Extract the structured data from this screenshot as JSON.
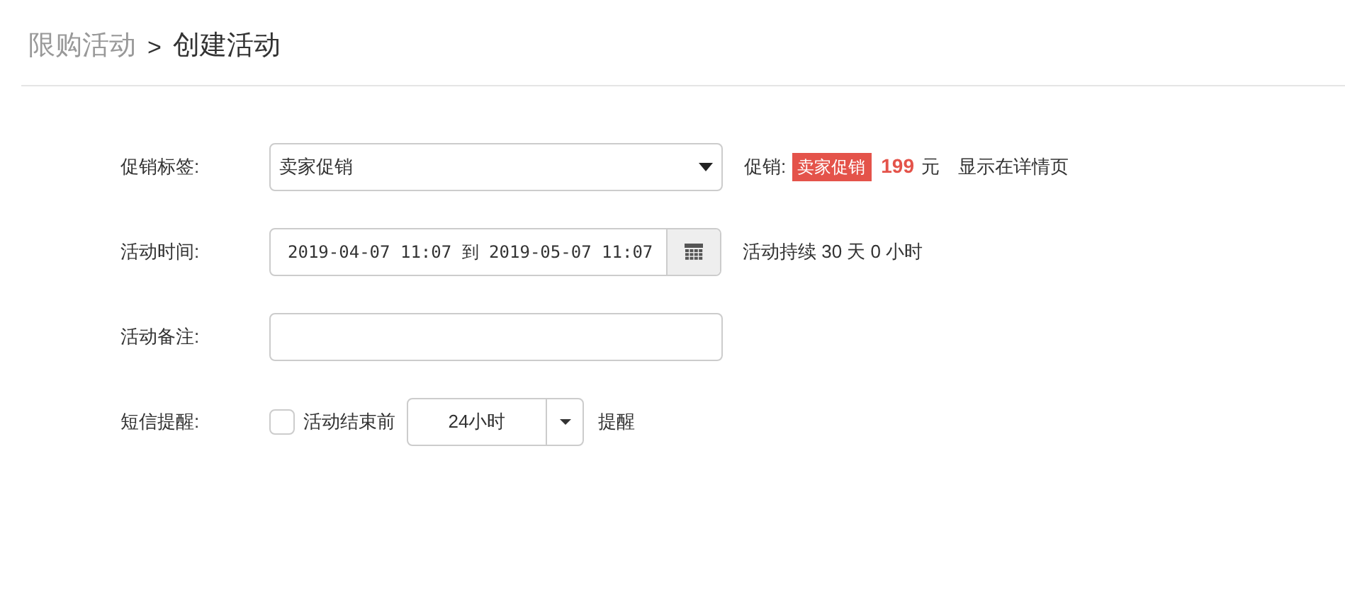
{
  "breadcrumb": {
    "parent": "限购活动",
    "separator": ">",
    "current": "创建活动"
  },
  "promo_tag": {
    "label": "促销标签:",
    "value": "卖家促销",
    "preview_label": "促销:",
    "badge": "卖家促销",
    "price": "199",
    "unit": "元",
    "note": "显示在详情页"
  },
  "time": {
    "label": "活动时间:",
    "value": "2019-04-07 11:07 到 2019-05-07 11:07",
    "duration": "活动持续 30 天 0 小时"
  },
  "remark": {
    "label": "活动备注:"
  },
  "sms": {
    "label": "短信提醒:",
    "checked": false,
    "checkbox_label": "活动结束前",
    "hours": "24小时",
    "suffix": "提醒"
  }
}
